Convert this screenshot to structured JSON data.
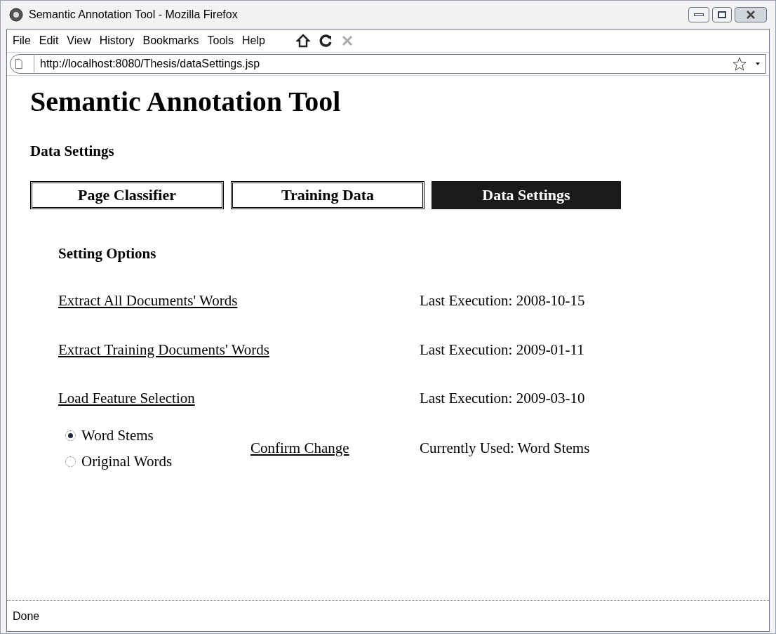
{
  "window": {
    "title": "Semantic Annotation Tool - Mozilla Firefox"
  },
  "menu": [
    "File",
    "Edit",
    "View",
    "History",
    "Bookmarks",
    "Tools",
    "Help"
  ],
  "address_bar": {
    "value": "http://localhost:8080/Thesis/dataSettings.jsp"
  },
  "page": {
    "title": "Semantic Annotation Tool",
    "subtitle": "Data Settings",
    "tabs": [
      {
        "label": "Page Classifier",
        "selected": false
      },
      {
        "label": "Training Data",
        "selected": false
      },
      {
        "label": "Data Settings",
        "selected": true
      }
    ],
    "section_title": "Setting Options",
    "actions": [
      {
        "link": "Extract All Documents' Words",
        "info": "Last Execution: 2008-10-15"
      },
      {
        "link": "Extract Training Documents' Words",
        "info": "Last Execution: 2009-01-11"
      },
      {
        "link": "Load Feature Selection",
        "info": "Last Execution: 2009-03-10"
      }
    ],
    "options": [
      {
        "label": "Word Stems",
        "selected": true
      },
      {
        "label": "Original Words",
        "selected": false
      }
    ],
    "confirm_link": "Confirm Change",
    "current": "Currently Used: Word Stems"
  },
  "status_bar": {
    "text": "Done"
  }
}
